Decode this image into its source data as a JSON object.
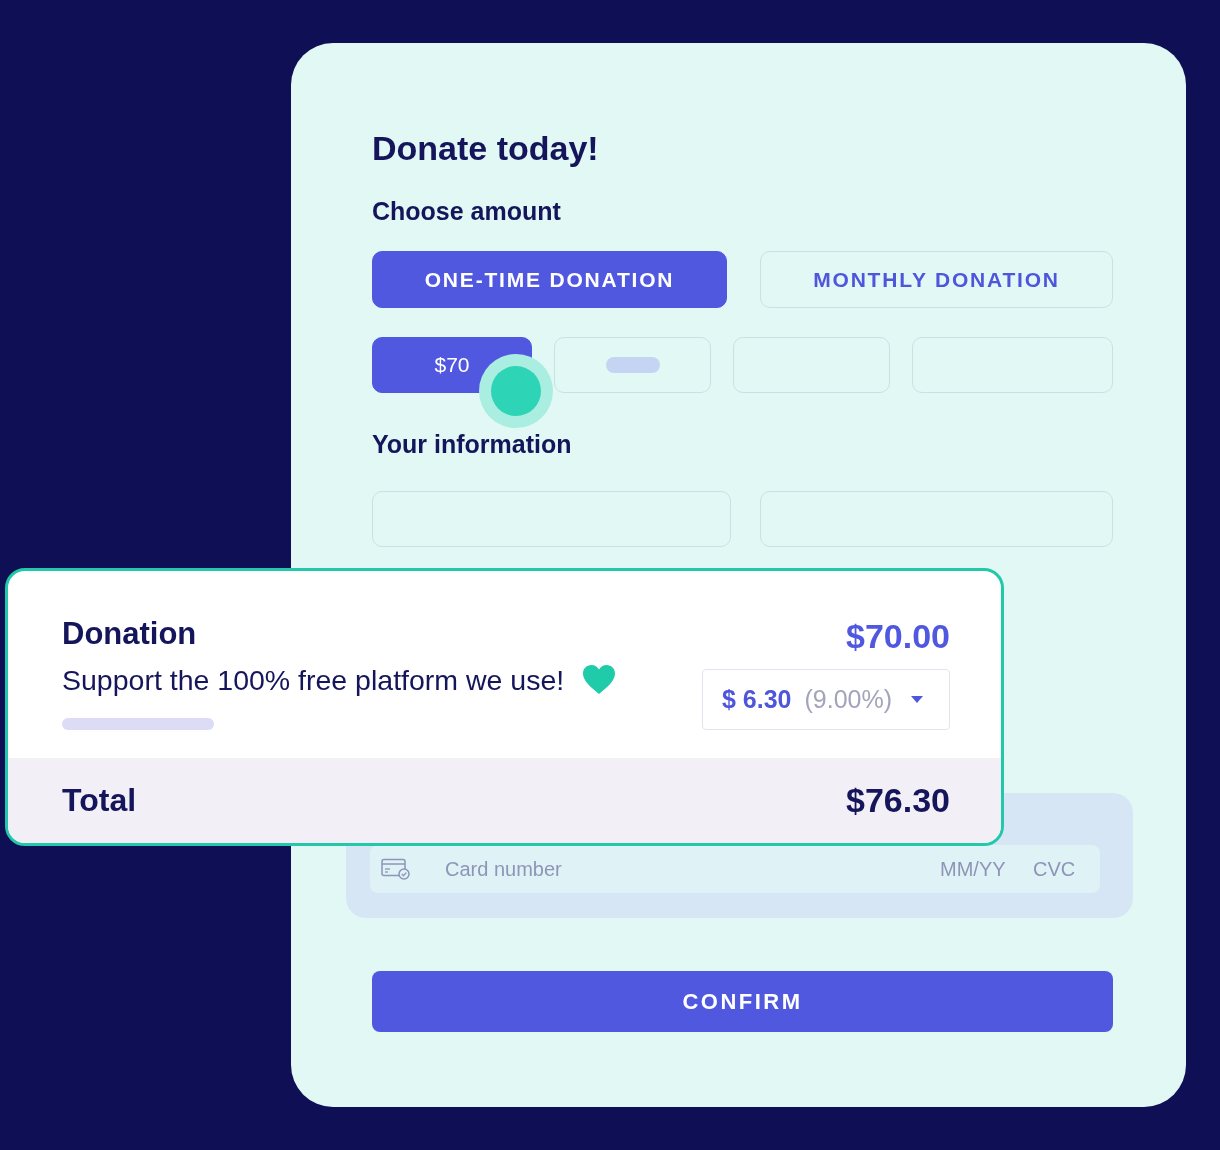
{
  "form": {
    "title": "Donate today!",
    "amount_heading": "Choose amount",
    "frequency_tabs": [
      {
        "label": "ONE-TIME DONATION",
        "selected": true
      },
      {
        "label": "MONTHLY DONATION",
        "selected": false
      }
    ],
    "amount_options": [
      {
        "kind": "value",
        "label": "$70",
        "selected": true
      },
      {
        "kind": "loading",
        "selected": false
      },
      {
        "kind": "blank",
        "selected": false
      },
      {
        "kind": "blank",
        "selected": false
      }
    ],
    "info_heading": "Your information",
    "info_fields": [
      {
        "kind": "text"
      },
      {
        "kind": "text"
      }
    ],
    "payment": {
      "card_placeholder": "Card number",
      "expiry_placeholder": "MM/YY",
      "cvc_placeholder": "CVC"
    },
    "confirm_button": "CONFIRM"
  },
  "summary": {
    "donation_label": "Donation",
    "donation_amount": "$70.00",
    "tip_text": "Support the 100% free platform we use!",
    "tip_amount": "$ 6.30",
    "tip_percent": "(9.00%)",
    "total_label": "Total",
    "total_amount": "$76.30"
  }
}
